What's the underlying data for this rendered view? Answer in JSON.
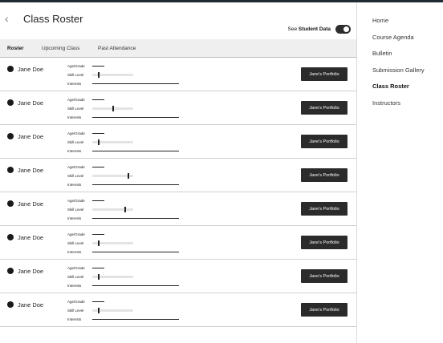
{
  "header": {
    "back_icon": "chevron-left-icon",
    "title": "Class Roster",
    "see_prefix": "See ",
    "see_bold": "Student Data"
  },
  "toggle": {
    "on": true
  },
  "tabs": [
    {
      "label": "Roster",
      "active": true
    },
    {
      "label": "Upcoming Class",
      "active": false
    },
    {
      "label": "Past Attendance",
      "active": false
    }
  ],
  "field_labels": {
    "age": "Age/Grade",
    "skill": "Skill Level",
    "interests": "Interests"
  },
  "students": [
    {
      "name": "Jane Doe",
      "button": "Jane's Portfolio",
      "skill": 0.15
    },
    {
      "name": "Jane Doe",
      "button": "Jane's Portfolio",
      "skill": 0.52
    },
    {
      "name": "Jane Doe",
      "button": "Jane's Portfolio",
      "skill": 0.15
    },
    {
      "name": "Jane Doe",
      "button": "Jane's Portfolio",
      "skill": 0.9
    },
    {
      "name": "Jane Doe",
      "button": "Jane's Portfolio",
      "skill": 0.82
    },
    {
      "name": "Jane Doe",
      "button": "Jane's Portfolio",
      "skill": 0.15
    },
    {
      "name": "Jane Doe",
      "button": "Jane's Portfolio",
      "skill": 0.15
    },
    {
      "name": "Jane Doe",
      "button": "Jane's Portfolio",
      "skill": 0.15
    }
  ],
  "sidebar": {
    "items": [
      {
        "label": "Home",
        "active": false
      },
      {
        "label": "Course Agenda",
        "active": false
      },
      {
        "label": "Bulletin",
        "active": false
      },
      {
        "label": "Submission Gallery",
        "active": false
      },
      {
        "label": "Class Roster",
        "active": true
      },
      {
        "label": "Instructors",
        "active": false
      }
    ]
  }
}
